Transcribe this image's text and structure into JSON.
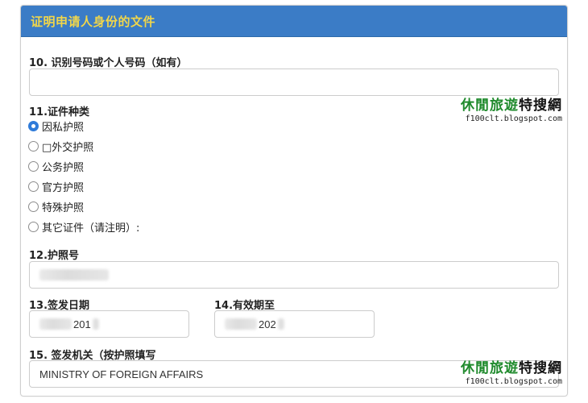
{
  "panel": {
    "title": "证明申请人身份的文件"
  },
  "colors": {
    "header_bg": "#3b7cc6",
    "header_text": "#f1d64a",
    "radio_checked": "#2f7bd9",
    "watermark_green": "#1f8a2c"
  },
  "fields": {
    "id_number": {
      "label": "10. 识别号码或个人号码（如有）",
      "value": ""
    },
    "doc_type": {
      "label": "11.证件种类",
      "options": [
        {
          "label": "因私护照",
          "checked": true
        },
        {
          "label": "□外交护照",
          "checked": false
        },
        {
          "label": "公务护照",
          "checked": false
        },
        {
          "label": "官方护照",
          "checked": false
        },
        {
          "label": "特殊护照",
          "checked": false
        },
        {
          "label": "其它证件（请注明）:",
          "checked": false
        }
      ]
    },
    "passport_no": {
      "label": "12.护照号",
      "value_hidden": true
    },
    "issue_date": {
      "label": "13.签发日期",
      "value_visible": "201"
    },
    "expiry_date": {
      "label": "14.有效期至",
      "value_visible": "202"
    },
    "issuing_authority": {
      "label": "15. 签发机关（按护照填写",
      "value": "MINISTRY OF FOREIGN AFFAIRS"
    }
  },
  "watermark": {
    "title_part1": "休閒",
    "title_part2": "旅遊",
    "title_part3": "特搜網",
    "url": "f100clt.blogspot.com"
  }
}
